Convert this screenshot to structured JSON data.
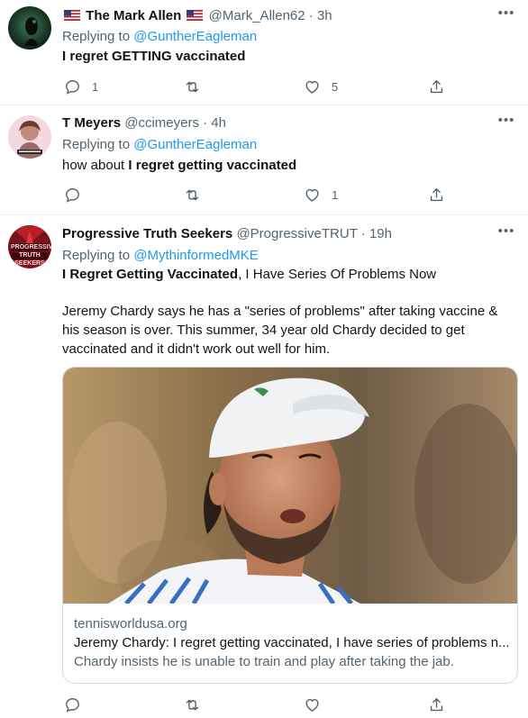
{
  "tweets": [
    {
      "display_name": "The Mark Allen",
      "handle": "@Mark_Allen62",
      "time": "3h",
      "replying_prefix": "Replying to ",
      "replying_to": "@GuntherEagleman",
      "text_bold": "I regret GETTING vaccinated",
      "counts": {
        "replies": "1",
        "retweets": "",
        "likes": "5"
      }
    },
    {
      "display_name": "T Meyers",
      "handle": "@ccimeyers",
      "time": "4h",
      "replying_prefix": "Replying to ",
      "replying_to": "@GuntherEagleman",
      "text_plain": "how about ",
      "text_bold": "I regret getting vaccinated",
      "counts": {
        "replies": "",
        "retweets": "",
        "likes": "1"
      }
    },
    {
      "display_name": "Progressive Truth Seekers",
      "handle": "@ProgressiveTRUT",
      "time": "19h",
      "replying_prefix": "Replying to ",
      "replying_to": "@MythinformedMKE",
      "text_bold": "I Regret Getting Vaccinated",
      "text_plain": ", I Have Series Of Problems Now",
      "body": "Jeremy Chardy says he has a \"series of problems\" after taking vaccine & his season is over. This summer, 34 year old Chardy decided to get vaccinated and it didn't work out well for him.",
      "card": {
        "domain": "tennisworldusa.org",
        "title": "Jeremy Chardy: I regret getting vaccinated, I have series of problems n...",
        "description": "Chardy insists he is unable to train and play after taking the jab."
      },
      "counts": {
        "replies": "",
        "retweets": "",
        "likes": ""
      }
    }
  ],
  "avatar_badge_text": "PROGRESSIVE TRUTH SEEKERS",
  "separator": " · ",
  "more_icon": "more-horizontal-icon",
  "colors": {
    "link": "#1d9bf0",
    "secondary": "#536471",
    "text": "#0f1419",
    "border": "#cfd9de"
  }
}
